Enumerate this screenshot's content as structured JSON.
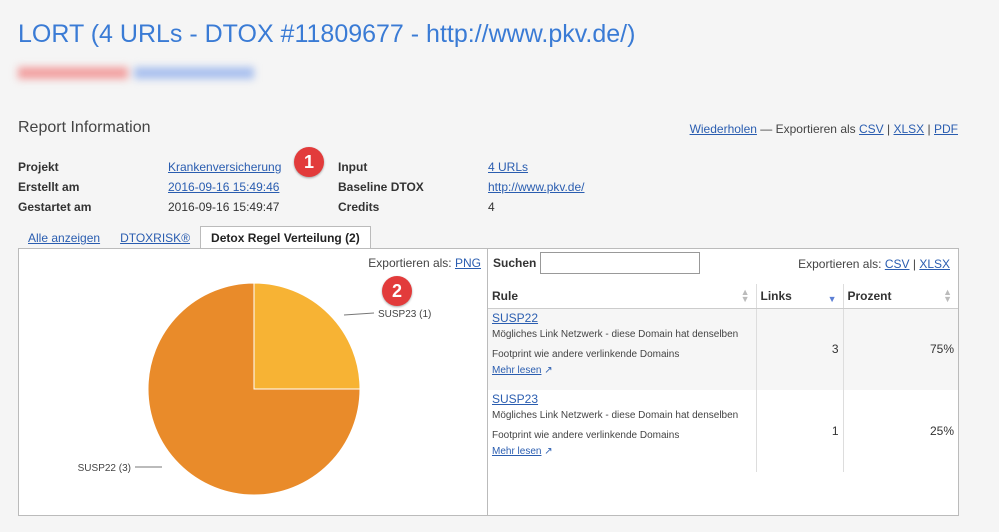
{
  "header": {
    "title": "LORT (4 URLs - DTOX #11809677 - http://www.pkv.de/)"
  },
  "report": {
    "title": "Report Information",
    "repeat_link": "Wiederholen",
    "export_prefix": "— Exportieren als",
    "export_csv": "CSV",
    "export_xlsx": "XLSX",
    "export_pdf": "PDF",
    "sep": "|"
  },
  "info_left": [
    {
      "label": "Projekt",
      "value": "Krankenversicherung",
      "link": true
    },
    {
      "label": "Erstellt am",
      "value": "2016-09-16 15:49:46",
      "link": true
    },
    {
      "label": "Gestartet am",
      "value": "2016-09-16 15:49:47",
      "link": false
    }
  ],
  "info_right": [
    {
      "label": "Input",
      "value": "4 URLs",
      "link": true
    },
    {
      "label": "Baseline DTOX",
      "value": "http://www.pkv.de/",
      "link": true
    },
    {
      "label": "Credits",
      "value": "4",
      "link": false
    }
  ],
  "badges": {
    "one": "1",
    "two": "2"
  },
  "tabs": [
    {
      "label": "Alle anzeigen",
      "active": false
    },
    {
      "label": "DTOXRISK®",
      "active": false
    },
    {
      "label": "Detox Regel Verteilung (2)",
      "active": true
    }
  ],
  "chart_panel": {
    "export_label": "Exportieren als:",
    "export_png": "PNG"
  },
  "chart_data": {
    "type": "pie",
    "slices": [
      {
        "label": "SUSP23 (1)",
        "value": 1,
        "percent": 25,
        "color": "#f7b334"
      },
      {
        "label": "SUSP22 (3)",
        "value": 3,
        "percent": 75,
        "color": "#e98b2a"
      }
    ]
  },
  "table_panel": {
    "search_label": "Suchen",
    "search_value": "",
    "export_label": "Exportieren als:",
    "export_csv": "CSV",
    "export_xlsx": "XLSX",
    "sep": "|",
    "columns": [
      "Rule",
      "Links",
      "Prozent"
    ],
    "rows": [
      {
        "rule": "SUSP22",
        "desc": "Mögliches Link Netzwerk - diese Domain hat denselben Footprint wie andere verlinkende Domains",
        "more": "Mehr lesen",
        "links": "3",
        "percent": "75%"
      },
      {
        "rule": "SUSP23",
        "desc": "Mögliches Link Netzwerk - diese Domain hat denselben Footprint wie andere verlinkende Domains",
        "more": "Mehr lesen",
        "links": "1",
        "percent": "25%"
      }
    ]
  }
}
